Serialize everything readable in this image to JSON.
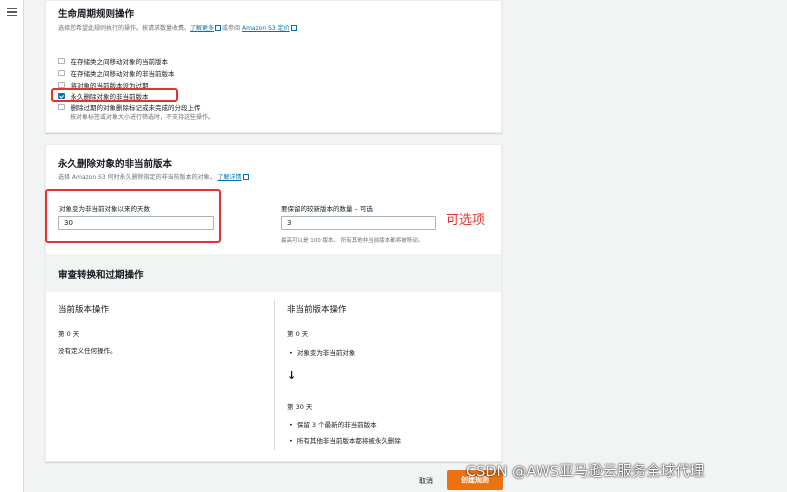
{
  "lifecycle": {
    "title": "生命周期规则操作",
    "desc_prefix": "选择您希望此规则执行的操作。按请求数量收费。",
    "learn_more": "了解更多",
    "desc_mid": "或参阅",
    "pricing": "Amazon S3 定价",
    "options": [
      {
        "label": "在存储类之间移动对象的当前版本",
        "checked": false
      },
      {
        "label": "在存储类之间移动对象的非当前版本",
        "checked": false
      },
      {
        "label": "将对象的当前版本设为过期",
        "checked": false
      },
      {
        "label": "永久删除对象的非当前版本",
        "checked": true
      },
      {
        "label": "删除过期的对象删除标记或未完成的分段上传",
        "checked": false
      }
    ],
    "last_option_hint": "按对象标签或对象大小进行筛选时，不支持这些操作。"
  },
  "delete_noncurrent": {
    "title": "永久删除对象的非当前版本",
    "desc_prefix": "选择 Amazon S3 何时永久删除指定的非当前版本的对象。",
    "learn_more": "了解详情",
    "days_label": "对象变为非当前对象以来的天数",
    "days_value": "30",
    "versions_label": "要保留的较新版本的数量 – 可选",
    "versions_value": "3",
    "versions_hint": "最高可以是 100 版本。 所有其他非当前版本都将被移动。",
    "annotation": "可选项"
  },
  "review": {
    "title": "审查转换和过期操作",
    "current": {
      "title": "当前版本操作",
      "day": "第 0 天",
      "text": "没有定义任何操作。"
    },
    "noncurrent": {
      "title": "非当前版本操作",
      "day0": "第 0 天",
      "bullet0": "对象变为非当前对象",
      "arrow": "↓",
      "day30": "第 30 天",
      "bullets30": [
        "保留 3 个最新的非当前版本",
        "所有其他非当前版本都将被永久删除"
      ]
    }
  },
  "footer": {
    "cancel": "取消",
    "create": "创建规则"
  },
  "watermark": "CSDN @AWS亚马逊云服务全球代理"
}
